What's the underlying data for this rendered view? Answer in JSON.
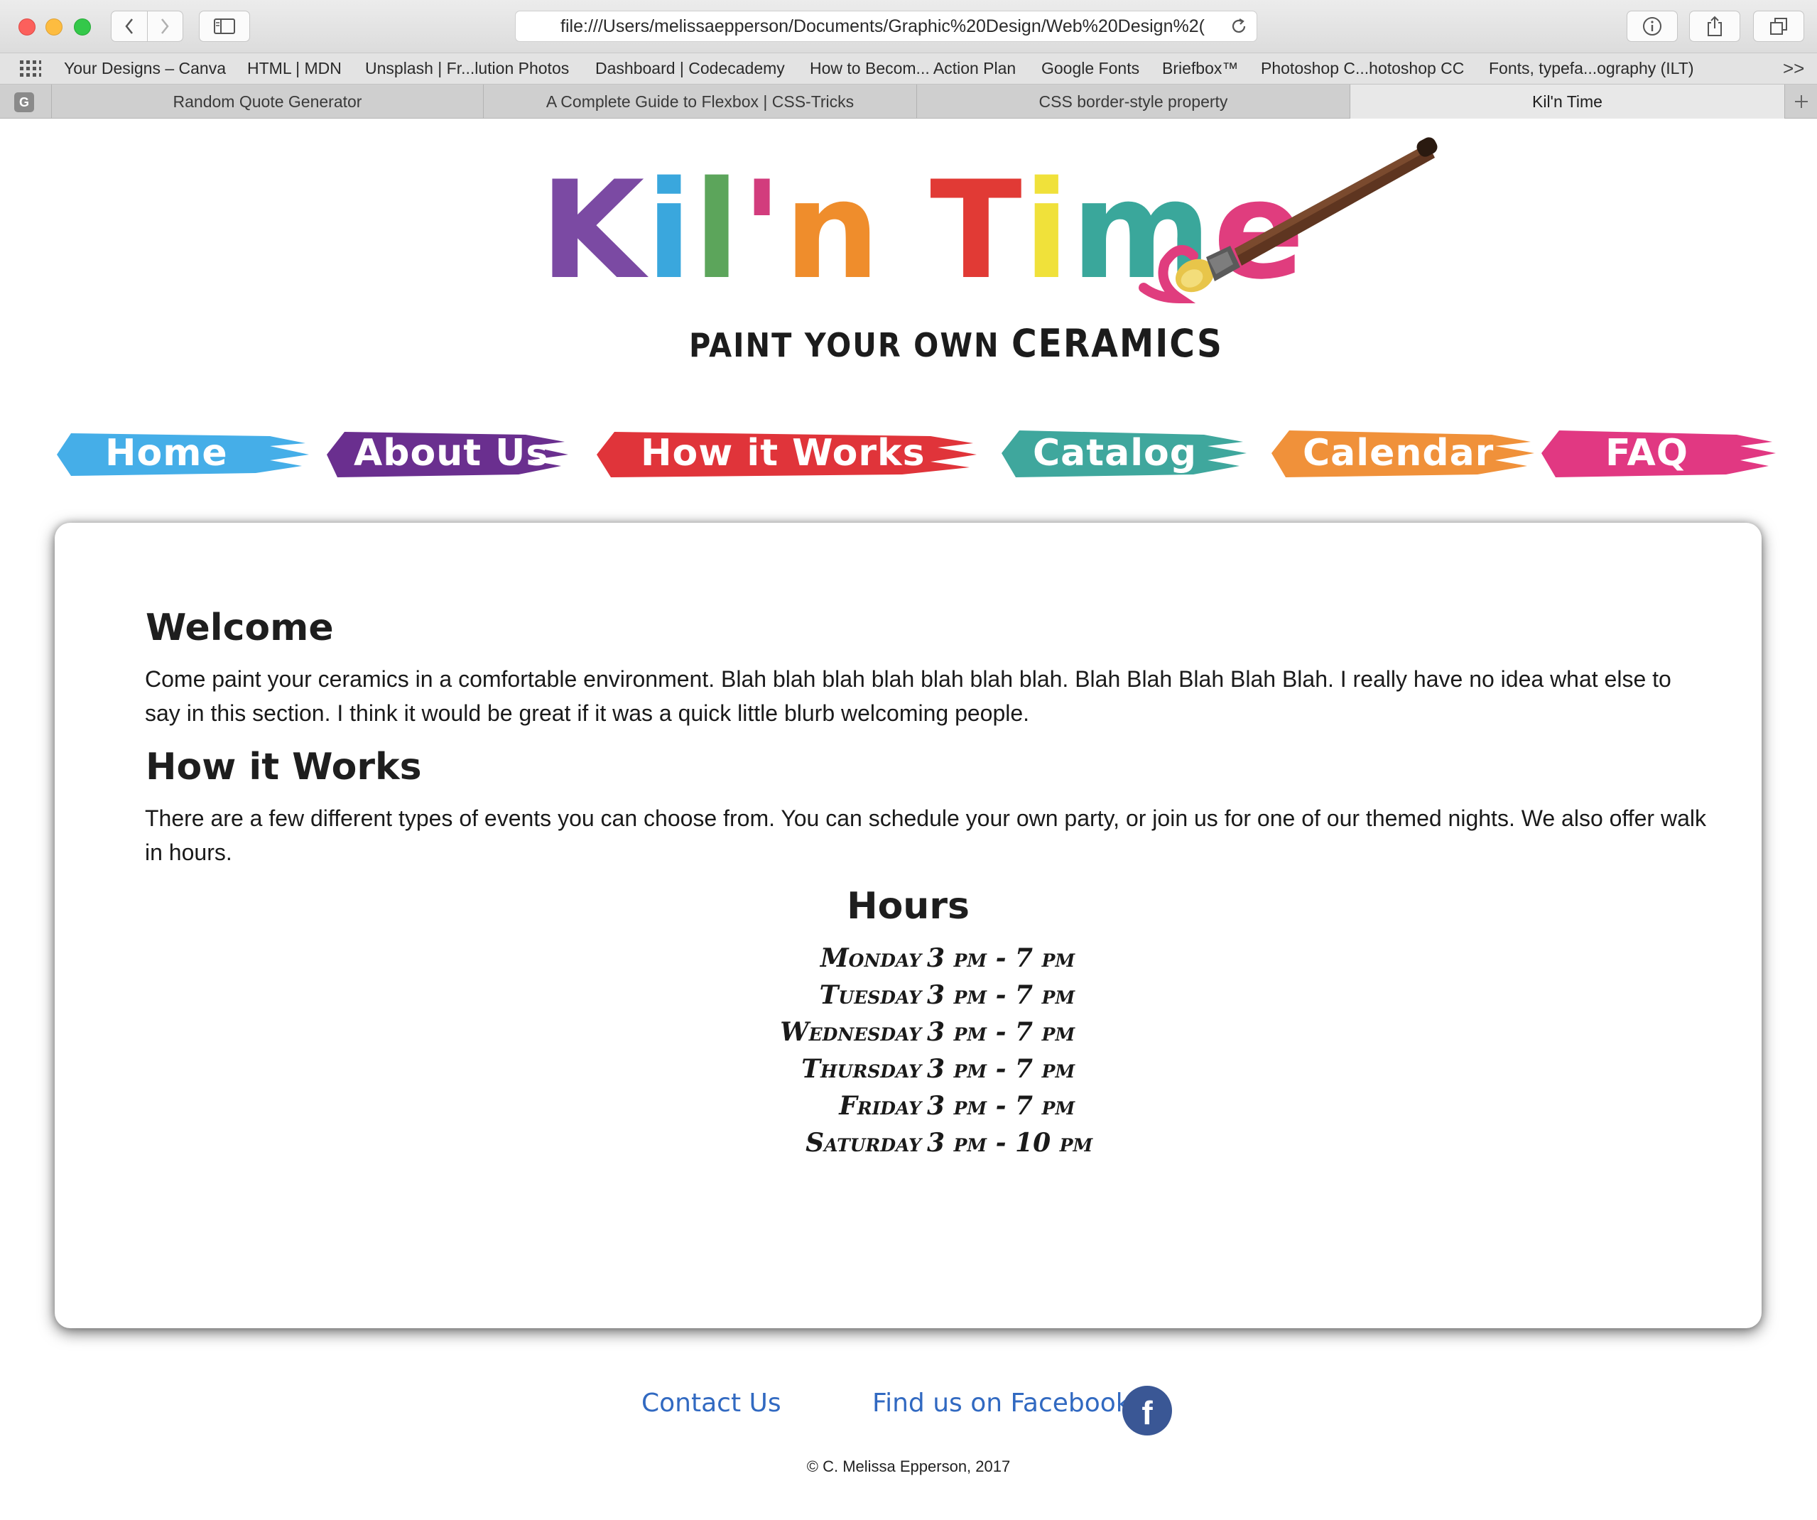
{
  "browser": {
    "url": "file:///Users/melissaepperson/Documents/Graphic%20Design/Web%20Design%2(",
    "bookmarks": [
      "Your Designs – Canva",
      "HTML | MDN",
      "Unsplash | Fr...lution Photos",
      "Dashboard | Codecademy",
      "How to Becom... Action Plan",
      "Google Fonts",
      "Briefbox™",
      "Photoshop C...hotoshop CC",
      "Fonts, typefa...ography (ILT)"
    ],
    "more_label": ">>",
    "pinned_tab_letter": "G",
    "tabs": [
      {
        "label": "Random Quote Generator"
      },
      {
        "label": "A Complete Guide to Flexbox | CSS-Tricks"
      },
      {
        "label": "CSS border-style property"
      },
      {
        "label": "Kil'n Time",
        "active": true
      }
    ]
  },
  "logo": {
    "letters": [
      {
        "ch": "K",
        "color": "#7b4aa3"
      },
      {
        "ch": "i",
        "color": "#3aa7dd"
      },
      {
        "ch": "l",
        "color": "#5ca55b"
      },
      {
        "ch": "'",
        "color": "#d23c7d"
      },
      {
        "ch": "n",
        "color": "#ef8d2c"
      },
      {
        "ch": " ",
        "color": "#000000"
      },
      {
        "ch": "T",
        "color": "#e13a35"
      },
      {
        "ch": "i",
        "color": "#f0e13a"
      },
      {
        "ch": "m",
        "color": "#3aa79b"
      },
      {
        "ch": "e",
        "color": "#e03d7e"
      }
    ],
    "subtitle_small": "PAINT YOUR OWN",
    "subtitle_big": "CERAMICS"
  },
  "nav": [
    {
      "label": "Home",
      "color": "#45aee8"
    },
    {
      "label": "About Us",
      "color": "#6a2f8f"
    },
    {
      "label": "How it Works",
      "color": "#e0343a"
    },
    {
      "label": "Catalog",
      "color": "#3fa79d"
    },
    {
      "label": "Calendar",
      "color": "#f0913a"
    },
    {
      "label": "FAQ",
      "color": "#e13882"
    }
  ],
  "main": {
    "welcome_heading": "Welcome",
    "welcome_text": "Come paint your ceramics in a comfortable environment. Blah blah blah blah blah blah blah. Blah Blah Blah Blah Blah. I really have no idea what else to say in this section. I think it would be great if it was a quick little blurb welcoming people.",
    "how_heading": "How it Works",
    "how_text": "There are a few different types of events you can choose from. You can schedule your own party, or join us for one of our themed nights. We also offer walk in hours.",
    "hours_heading": "Hours",
    "hours": [
      {
        "day": "Monday",
        "time": "3 pm - 7 pm"
      },
      {
        "day": "Tuesday",
        "time": "3 pm - 7 pm"
      },
      {
        "day": "Wednesday",
        "time": "3 pm - 7 pm"
      },
      {
        "day": "Thursday",
        "time": "3 pm - 7 pm"
      },
      {
        "day": "Friday",
        "time": "3 pm - 7 pm"
      },
      {
        "day": "Saturday",
        "time": "3 pm - 10 pm"
      }
    ]
  },
  "footer": {
    "contact_label": "Contact Us",
    "facebook_label": "Find us on Facebook",
    "facebook_icon_letter": "f",
    "copyright": "© C. Melissa Epperson, 2017"
  }
}
